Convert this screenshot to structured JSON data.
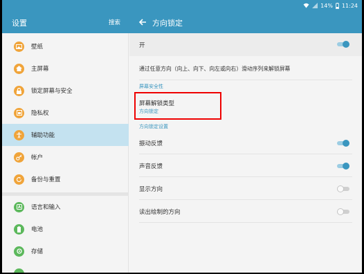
{
  "status": {
    "battery": "14%",
    "time": "11:24"
  },
  "appbar": {
    "left_title": "设置",
    "search_label": "搜索",
    "right_title": "方向锁定"
  },
  "sidebar": {
    "items": [
      {
        "label": "壁纸",
        "icon": "wallpaper-icon",
        "color": "#f0a43a"
      },
      {
        "label": "主屏幕",
        "icon": "home-icon",
        "color": "#f0a43a"
      },
      {
        "label": "锁定屏幕与安全",
        "icon": "lock-icon",
        "color": "#f0a43a"
      },
      {
        "label": "隐私权",
        "icon": "privacy-icon",
        "color": "#f0a43a"
      },
      {
        "label": "辅助功能",
        "icon": "accessibility-icon",
        "color": "#f0a43a"
      },
      {
        "label": "帐户",
        "icon": "key-icon",
        "color": "#f0a43a"
      },
      {
        "label": "备份与重置",
        "icon": "backup-icon",
        "color": "#f0a43a"
      },
      {
        "label": "语言和输入",
        "icon": "language-icon",
        "color": "#5cb85c"
      },
      {
        "label": "电池",
        "icon": "battery-icon",
        "color": "#5cb85c"
      },
      {
        "label": "存储",
        "icon": "storage-icon",
        "color": "#5cb85c"
      }
    ]
  },
  "main": {
    "master_toggle": {
      "label": "开",
      "on": true
    },
    "description": "通过任意方向（向上、向下、向左或向右）滑动序列来解锁屏幕",
    "section_security": "屏幕安全性",
    "unlock_type": {
      "label": "屏幕解锁类型",
      "value": "方向锁定"
    },
    "section_settings": "方向锁定设置",
    "options": [
      {
        "label": "振动反馈",
        "on": true
      },
      {
        "label": "声音反馈",
        "on": true
      },
      {
        "label": "显示方向",
        "on": false
      },
      {
        "label": "读出绘制的方向",
        "on": false
      }
    ]
  },
  "colors": {
    "accent": "#3a96bf",
    "highlight": "#ee0000"
  }
}
